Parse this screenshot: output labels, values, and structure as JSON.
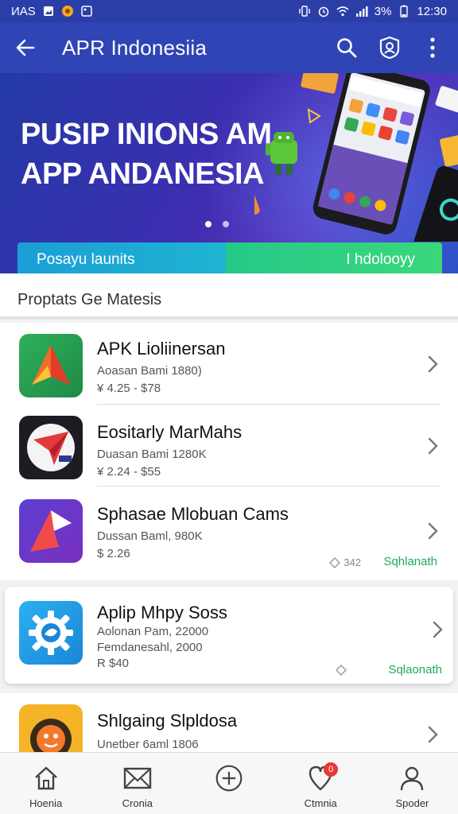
{
  "status_bar": {
    "left_text": "ИАS",
    "time": "12:30",
    "battery": "3%"
  },
  "app_bar": {
    "title": "APR Indonesiia"
  },
  "banner": {
    "title_line1": "PUSIP INIONS AM",
    "title_line2": "APP ANDANESIA",
    "tab_left": "Posayu launits",
    "tab_right": "I hdolooyy",
    "active_slide": 1,
    "slide_count": 2
  },
  "section": {
    "title": "Proptats Ge Matesis"
  },
  "apps": [
    {
      "name": "APK Lioliinersan",
      "sub": "Aoasan Bami 1880)",
      "price": "¥ 4.25 - $78"
    },
    {
      "name": "Eositarly MarMahs",
      "sub": "Duasan Bami 1280K",
      "price": "¥ 2.24 - $55"
    },
    {
      "name": "Sphasae Mlobuan Cams",
      "sub": "Dussan Baml, 980K",
      "price": "$ 2.26",
      "meta_left": "342",
      "meta_right": "Sqhlanath"
    },
    {
      "name": "Aplip Mhpy Soss",
      "sub": "Aolonan Pam, 22000",
      "sub2": "Femdanesahl, 2000",
      "price": "R $40",
      "meta_right": "Sqlaonath"
    },
    {
      "name": "Shlgaing Slpldosa",
      "sub": "Unetber 6aml 1806"
    }
  ],
  "bottom_nav": [
    {
      "label": "Hoenia",
      "icon": "home-icon"
    },
    {
      "label": "Cronia",
      "icon": "envelope-icon"
    },
    {
      "label": "",
      "icon": "add-circle-icon"
    },
    {
      "label": "Ctmnia",
      "icon": "heart-pin-icon",
      "badge": "0"
    },
    {
      "label": "Spoder",
      "icon": "user-icon"
    }
  ],
  "colors": {
    "primary": "#2f45b5",
    "tab_left": "#1a9fd6",
    "tab_right": "#26c98a",
    "accent_green": "#1faa5a",
    "badge": "#e53935"
  }
}
